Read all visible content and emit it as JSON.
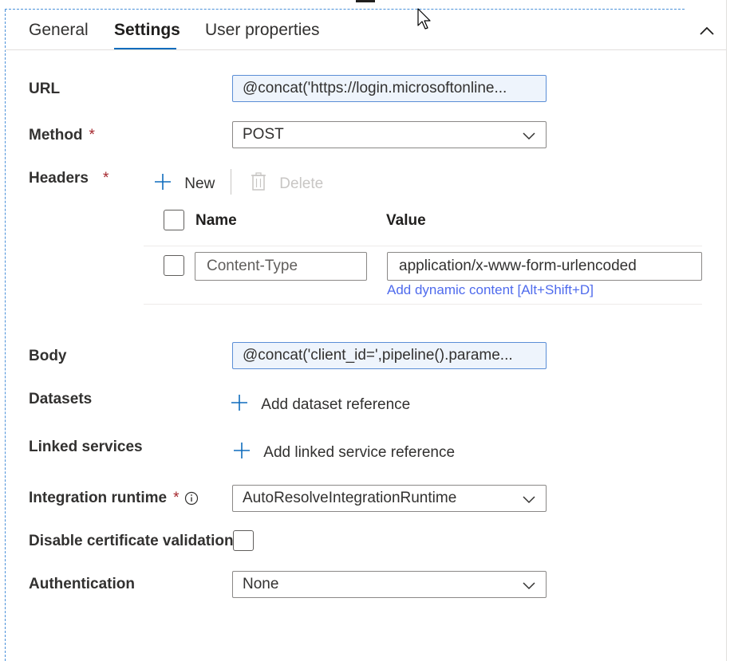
{
  "tabs": [
    {
      "label": "General",
      "active": false
    },
    {
      "label": "Settings",
      "active": true
    },
    {
      "label": "User properties",
      "active": false
    }
  ],
  "form": {
    "url": {
      "label": "URL",
      "value": "@concat('https://login.microsoftonline..."
    },
    "method": {
      "label": "Method",
      "required_mark": "*",
      "value": "POST"
    },
    "headers": {
      "label": "Headers",
      "required_mark": "*",
      "new_label": "New",
      "delete_label": "Delete",
      "columns": {
        "name": "Name",
        "value": "Value"
      },
      "rows": [
        {
          "name": "Content-Type",
          "value": "application/x-www-form-urlencoded",
          "dynamic_link": "Add dynamic content [Alt+Shift+D]"
        }
      ]
    },
    "body": {
      "label": "Body",
      "value": "@concat('client_id=',pipeline().parame..."
    },
    "datasets": {
      "label": "Datasets",
      "action": "Add dataset reference"
    },
    "linked_services": {
      "label": "Linked services",
      "action": "Add linked service reference"
    },
    "integration_runtime": {
      "label": "Integration runtime",
      "required_mark": "*",
      "value": "AutoResolveIntegrationRuntime"
    },
    "disable_cert": {
      "label": "Disable certificate validation",
      "checked": false
    },
    "authentication": {
      "label": "Authentication",
      "value": "None"
    }
  },
  "icons": {
    "collapse": "chevron-up-icon",
    "dropdown": "chevron-down-icon",
    "add": "plus-icon",
    "delete": "trash-icon",
    "info": "info-icon"
  },
  "colors": {
    "accent": "#0f6cbd",
    "link": "#4f6bed",
    "required": "#a4262c",
    "expression_bg": "#eef4fc"
  }
}
